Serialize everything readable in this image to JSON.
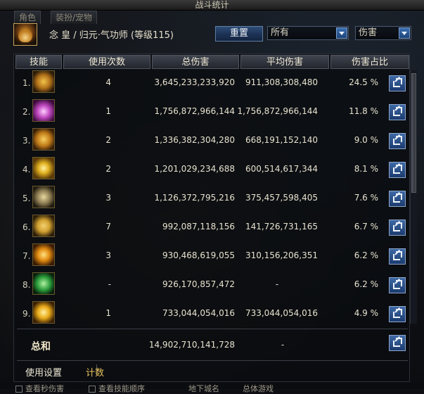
{
  "window": {
    "title": "战斗统计"
  },
  "background_tabs": [
    "角色",
    "装扮/宠物"
  ],
  "character": {
    "line": "念 皇  / 归元·气功师 (等级115)"
  },
  "toolbar": {
    "reset_label": "重置",
    "filter_value": "所有",
    "stat_value": "伤害"
  },
  "table": {
    "headers": [
      "技能",
      "使用次数",
      "总伤害",
      "平均伤害",
      "伤害占比"
    ],
    "rows": [
      {
        "rank": "1.",
        "uses": "4",
        "total": "3,645,233,233,920",
        "avg": "911,308,308,480",
        "pct": "24.5 %",
        "icon_color": "#c98a1c"
      },
      {
        "rank": "2.",
        "uses": "1",
        "total": "1,756,872,966,144",
        "avg": "1,756,872,966,144",
        "pct": "11.8 %",
        "icon_color": "#c048c0"
      },
      {
        "rank": "3.",
        "uses": "2",
        "total": "1,336,382,304,280",
        "avg": "668,191,152,140",
        "pct": "9.0 %",
        "icon_color": "#d89a28"
      },
      {
        "rank": "4.",
        "uses": "2",
        "total": "1,201,029,234,688",
        "avg": "600,514,617,344",
        "pct": "8.1 %",
        "icon_color": "#e0b020"
      },
      {
        "rank": "5.",
        "uses": "3",
        "total": "1,126,372,795,216",
        "avg": "375,457,598,405",
        "pct": "7.6 %",
        "icon_color": "#8a7a50"
      },
      {
        "rank": "6.",
        "uses": "7",
        "total": "992,087,118,156",
        "avg": "141,726,731,165",
        "pct": "6.7 %",
        "icon_color": "#d0a030"
      },
      {
        "rank": "7.",
        "uses": "3",
        "total": "930,468,619,055",
        "avg": "310,156,206,351",
        "pct": "6.2 %",
        "icon_color": "#e08a10"
      },
      {
        "rank": "8.",
        "uses": "-",
        "total": "926,170,857,472",
        "avg": "-",
        "pct": "6.2 %",
        "icon_color": "#2a9a3a"
      },
      {
        "rank": "9.",
        "uses": "1",
        "total": "733,044,054,016",
        "avg": "733,044,054,016",
        "pct": "4.9 %",
        "icon_color": "#e8a818"
      }
    ]
  },
  "summary": {
    "label": "总和",
    "total": "14,902,710,141,728",
    "avg": "-"
  },
  "footer": {
    "settings_label": "使用设置",
    "count_label": "计数"
  },
  "bottom_options": [
    "查看秒伤害",
    "查看技能顺序",
    "地下城名",
    "总体游戏"
  ],
  "colors": {
    "accent_blue": "#2f4d78",
    "header_bg": "#3f444e",
    "footer_count": "#e8c15a"
  }
}
